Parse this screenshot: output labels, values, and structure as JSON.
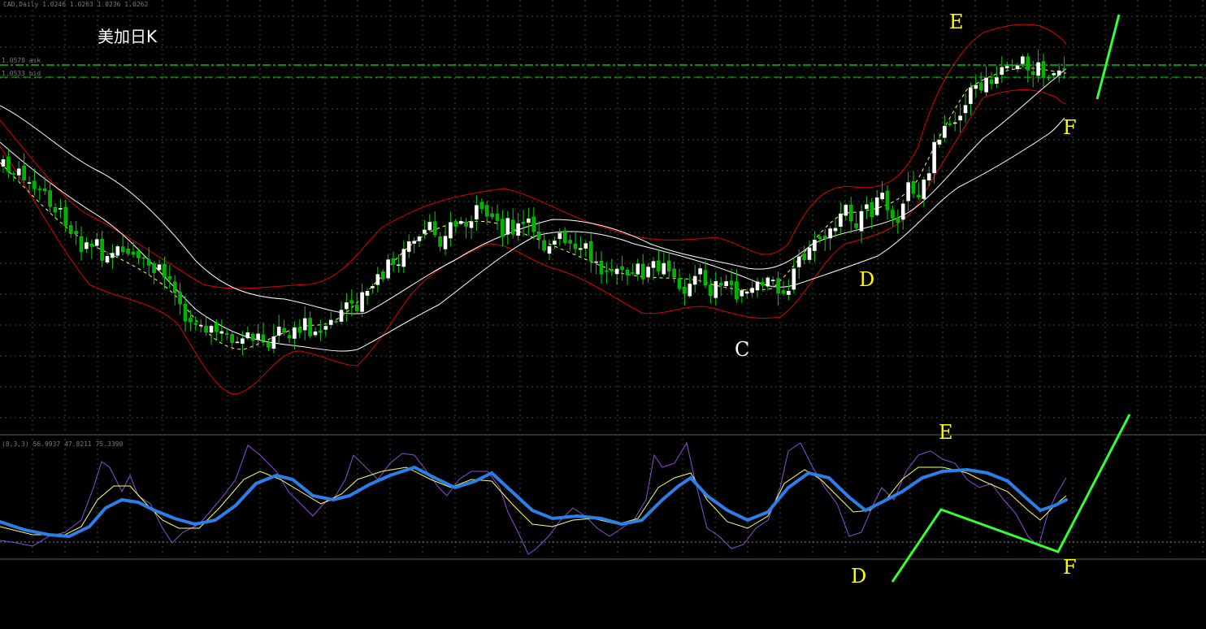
{
  "chart_data": [
    {
      "type": "candlestick",
      "header": "CAD,Daily  1.0246 1.0263 1.0236 1.0262",
      "title": "美加日K",
      "price_labels": [
        "1.0578 ask",
        "1.0533 bid"
      ],
      "annotations": [
        "E",
        "F",
        "D",
        "C"
      ],
      "colors": {
        "up": "#ffffff",
        "down": "#00d200",
        "envelope": "#e00000",
        "ma": "#ffffff",
        "mid": "#ffff66",
        "grid": "#445544",
        "level": "#00c800",
        "arrow": "#00ff00"
      }
    },
    {
      "type": "line",
      "header": "(8,3,3) 56.9937 47.8211 75.3390",
      "annotations": [
        "E",
        "D",
        "F"
      ],
      "colors": {
        "thick": "#2b7fe8",
        "thin": "#ffff66",
        "fast": "#8a4fd8",
        "arrow": "#33ff33"
      }
    }
  ]
}
